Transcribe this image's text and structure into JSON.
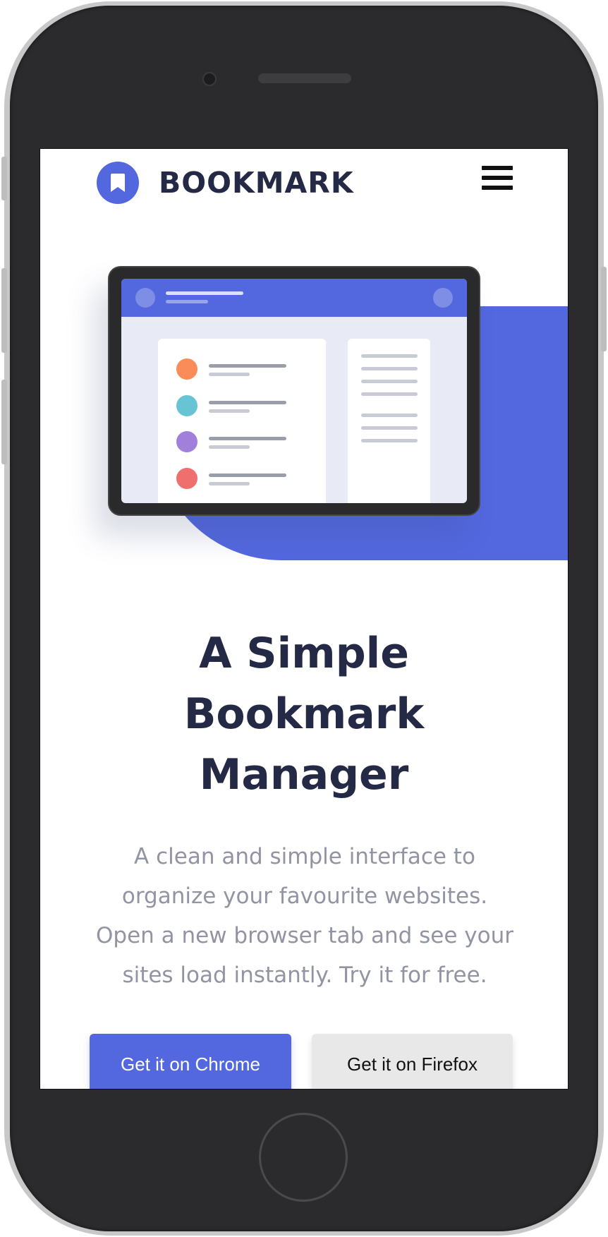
{
  "header": {
    "brand": "BOOKMARK",
    "logo_icon": "bookmark-icon",
    "menu_icon": "hamburger-menu-icon"
  },
  "hero": {
    "title_lines": [
      "A Simple",
      "Bookmark",
      "Manager"
    ],
    "description_lines": [
      "A clean and simple interface to",
      "organize your favourite websites.",
      "Open a new browser tab and see your",
      "sites load instantly. Try it for free."
    ],
    "cta_chrome": "Get it on Chrome",
    "cta_firefox": "Get it on Firefox"
  },
  "colors": {
    "accent": "#5368df",
    "heading": "#242a45",
    "muted_text": "#9194a2",
    "secondary_button": "#e8e8e8",
    "list_dot_colors": [
      "#f98c58",
      "#67c4d4",
      "#a180dc",
      "#ef6f6f"
    ]
  }
}
